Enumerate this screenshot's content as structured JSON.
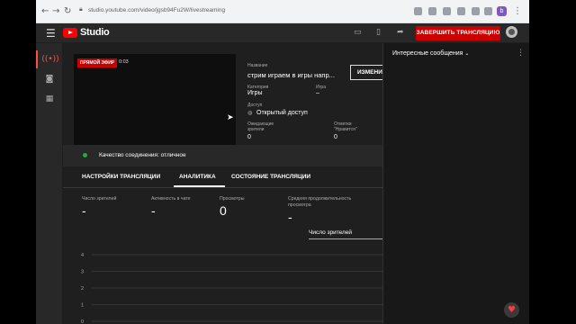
{
  "browser": {
    "url": "studio.youtube.com/video/jgsb94Fu2W/livestreaming",
    "nav_back": "←",
    "nav_forward": "→",
    "nav_reload": "↻",
    "lock_icon": "lock-icon",
    "profile_initial": "b"
  },
  "header": {
    "logo_text": "Studio",
    "end_stream_button": "ЗАВЕРШИТЬ ТРАНСЛЯЦИЮ"
  },
  "preview": {
    "live_badge": "ПРЯМОЙ ЭФИР",
    "elapsed": "0:03"
  },
  "stream_info": {
    "title_label": "Название",
    "title_value": "стрим играем в игры напр...",
    "category_label": "Категория",
    "category_value": "Игры",
    "game_label": "Игра",
    "game_value": "–",
    "access_label": "Доступ",
    "access_value": "Открытый доступ",
    "waiting_label_1": "Ожидающие",
    "waiting_label_2": "зрители",
    "waiting_value": "0",
    "likes_label_1": "Отметки",
    "likes_label_2": "\"Нравится\"",
    "likes_value": "0",
    "edit_button": "ИЗМЕНИТЬ"
  },
  "connection": {
    "status_text": "Качество соединения: отличное",
    "status_color": "#2ba640"
  },
  "tabs": [
    {
      "label": "НАСТРОЙКИ ТРАНСЛЯЦИИ"
    },
    {
      "label": "АНАЛИТИКА"
    },
    {
      "label": "СОСТОЯНИЕ ТРАНСЛЯЦИИ"
    }
  ],
  "metrics": [
    {
      "label": "Число зрителей",
      "value": "-"
    },
    {
      "label": "Активность в чате",
      "value": "-"
    },
    {
      "label": "Просмотры",
      "value": "0"
    },
    {
      "label_1": "Средняя продолжительность",
      "label_2": "просмотра",
      "value": "-"
    }
  ],
  "chart_dropdown": "Число зрителей",
  "chart_data": {
    "type": "line",
    "y_ticks": [
      "4",
      "3",
      "2",
      "1",
      "0"
    ],
    "ylim": [
      0,
      4
    ],
    "grid": true,
    "series": []
  },
  "chat": {
    "title": "Интересные сообщения"
  },
  "colors": {
    "accent": "#cc0000",
    "background": "#1f1f1f",
    "panel": "#282828"
  }
}
